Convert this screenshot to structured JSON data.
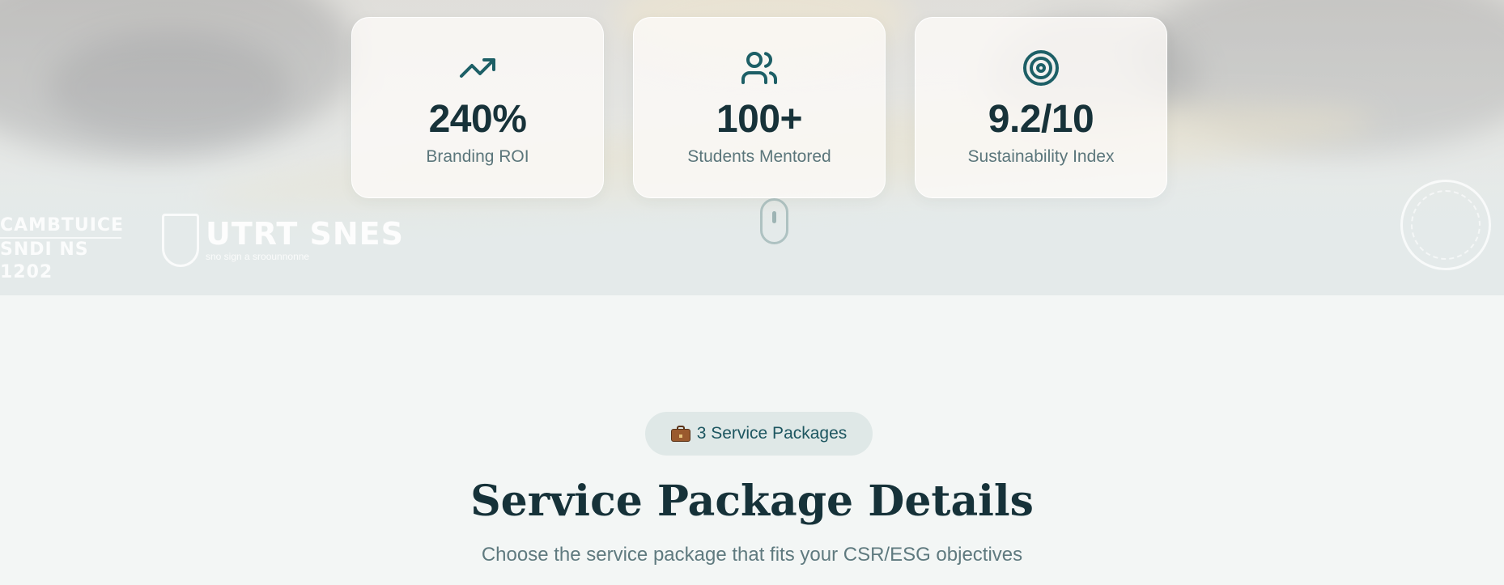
{
  "stats": [
    {
      "icon": "trending-up-icon",
      "value": "240%",
      "label": "Branding ROI"
    },
    {
      "icon": "users-icon",
      "value": "100+",
      "label": "Students Mentored"
    },
    {
      "icon": "target-icon",
      "value": "9.2/10",
      "label": "Sustainability Index"
    }
  ],
  "logos": {
    "left_line1": "CAMBTUICE",
    "left_line2": "SNDI NS 1202",
    "center_main": "UTRT SNES",
    "center_sub": "sno sign a sroounnonne"
  },
  "section": {
    "badge_icon": "briefcase-icon",
    "badge_label": "3 Service Packages",
    "title": "Service Package Details",
    "subtitle": "Choose the service package that fits your CSR/ESG objectives"
  },
  "colors": {
    "accent": "#1d5f66",
    "heading": "#163239",
    "muted": "#5b767b",
    "badge_bg": "#dfe8e7",
    "page_bg": "#f3f6f5"
  }
}
